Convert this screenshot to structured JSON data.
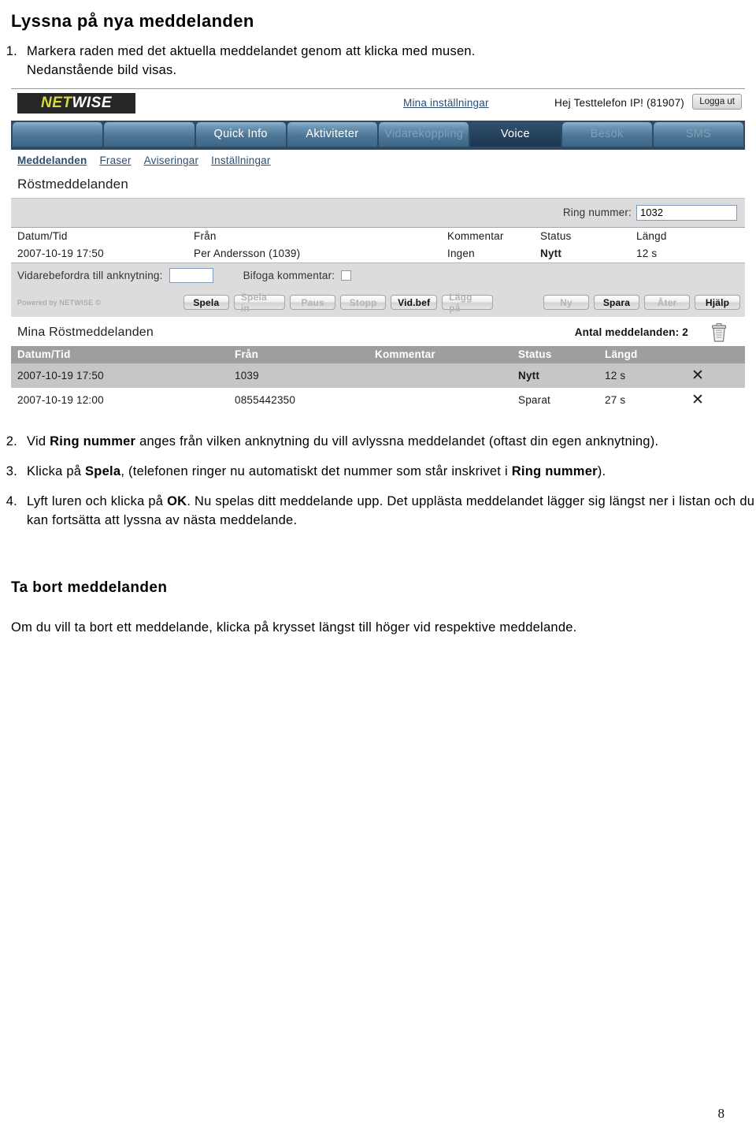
{
  "document": {
    "heading": "Lyssna på nya meddelanden",
    "step1": {
      "number": "1.",
      "line1": "Markera raden med det aktuella meddelandet genom att klicka med musen.",
      "line2": "Nedanstående bild visas."
    },
    "step2": {
      "number": "2.",
      "pre": "Vid ",
      "bold": "Ring nummer",
      "post": " anges från vilken anknytning du vill avlyssna meddelandet (oftast din egen anknytning)."
    },
    "step3": {
      "number": "3.",
      "pre": "Klicka på ",
      "bold1": "Spela",
      "mid": ", (telefonen ringer nu automatiskt det nummer som står inskrivet i ",
      "bold2": "Ring nummer",
      "post": ")."
    },
    "step4": {
      "number": "4.",
      "pre": "Lyft luren och klicka på ",
      "bold": "OK",
      "post": ". Nu spelas ditt meddelande upp. Det upplästa meddelandet lägger sig längst ner i listan och du kan fortsätta att lyssna av nästa meddelande."
    },
    "section2_heading": "Ta bort meddelanden",
    "section2_text": "Om du vill ta bort ett meddelande, klicka på krysset längst till höger vid respektive meddelande.",
    "page_number": "8"
  },
  "app": {
    "logo": {
      "part1": "NET",
      "part2": "WISE"
    },
    "header": {
      "settings_link": "Mina inställningar",
      "greeting": "Hej Testtelefon IP! (81907)",
      "logout_label": "Logga ut"
    },
    "tabs": [
      {
        "label": "",
        "state": "blank"
      },
      {
        "label": "",
        "state": "blank"
      },
      {
        "label": "Quick Info",
        "state": "normal"
      },
      {
        "label": "Aktiviteter",
        "state": "normal"
      },
      {
        "label": "Vidarekoppling",
        "state": "dim"
      },
      {
        "label": "Voice",
        "state": "active"
      },
      {
        "label": "Besök",
        "state": "dim"
      },
      {
        "label": "SMS",
        "state": "dim"
      }
    ],
    "subnav": [
      {
        "label": "Meddelanden",
        "current": true
      },
      {
        "label": "Fraser",
        "current": false
      },
      {
        "label": "Aviseringar",
        "current": false
      },
      {
        "label": "Inställningar",
        "current": false
      }
    ],
    "voicemail": {
      "section_title": "Röstmeddelanden",
      "ring_label": "Ring nummer:",
      "ring_value": "1032",
      "columns": [
        "Datum/Tid",
        "Från",
        "Kommentar",
        "Status",
        "Längd"
      ],
      "row": {
        "date": "2007-10-19 17:50",
        "from": "Per Andersson (1039)",
        "comment": "Ingen",
        "status": "Nytt",
        "length": "12 s"
      },
      "forward_label": "Vidarebefordra till anknytning:",
      "forward_value": "",
      "attach_label": "Bifoga kommentar:",
      "powered_by": "Powered by NETWISE ©",
      "buttons_left": [
        {
          "label": "Spela",
          "enabled": true
        },
        {
          "label": "Spela in",
          "enabled": false
        },
        {
          "label": "Paus",
          "enabled": false
        },
        {
          "label": "Stopp",
          "enabled": false
        },
        {
          "label": "Vid.bef",
          "enabled": true
        },
        {
          "label": "Lägg på",
          "enabled": false
        }
      ],
      "buttons_right": [
        {
          "label": "Ny",
          "enabled": false
        },
        {
          "label": "Spara",
          "enabled": true
        },
        {
          "label": "Åter",
          "enabled": false
        },
        {
          "label": "Hjälp",
          "enabled": true
        }
      ]
    },
    "mymessages": {
      "title": "Mina Röstmeddelanden",
      "count_label": "Antal meddelanden: 2",
      "trash_icon": "trash-icon",
      "columns": [
        "Datum/Tid",
        "Från",
        "Kommentar",
        "Status",
        "Längd"
      ],
      "rows": [
        {
          "date": "2007-10-19 17:50",
          "from": "1039",
          "comment": "",
          "status": "Nytt",
          "length": "12 s",
          "delete": "✕",
          "selected": true
        },
        {
          "date": "2007-10-19 12:00",
          "from": "0855442350",
          "comment": "",
          "status": "Sparat",
          "length": "27 s",
          "delete": "✕",
          "selected": false
        }
      ]
    }
  }
}
